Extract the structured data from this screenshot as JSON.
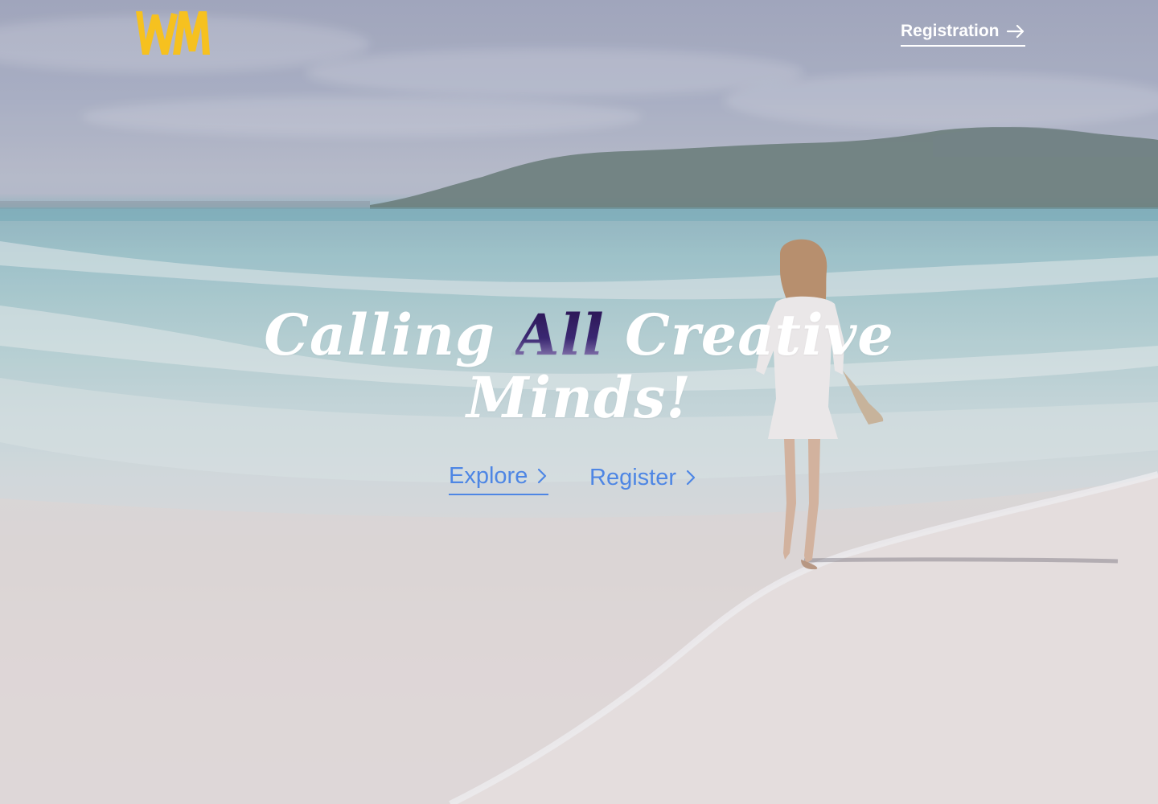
{
  "header": {
    "logo_text": "WM",
    "nav_register_label": "Registration"
  },
  "hero": {
    "headline_before": "Calling ",
    "headline_accent": "All",
    "headline_after": " Creative Minds!",
    "cta_explore_label": "Explore",
    "cta_register_label": "Register"
  },
  "colors": {
    "logo": "#f6c11f",
    "nav_text": "#ffffff",
    "headline_text": "#ffffff",
    "headline_accent": "#2a1252",
    "cta": "#4e86e4"
  },
  "icons": {
    "nav_arrow": "arrow-right-icon",
    "cta_chevron": "chevron-right-icon"
  }
}
